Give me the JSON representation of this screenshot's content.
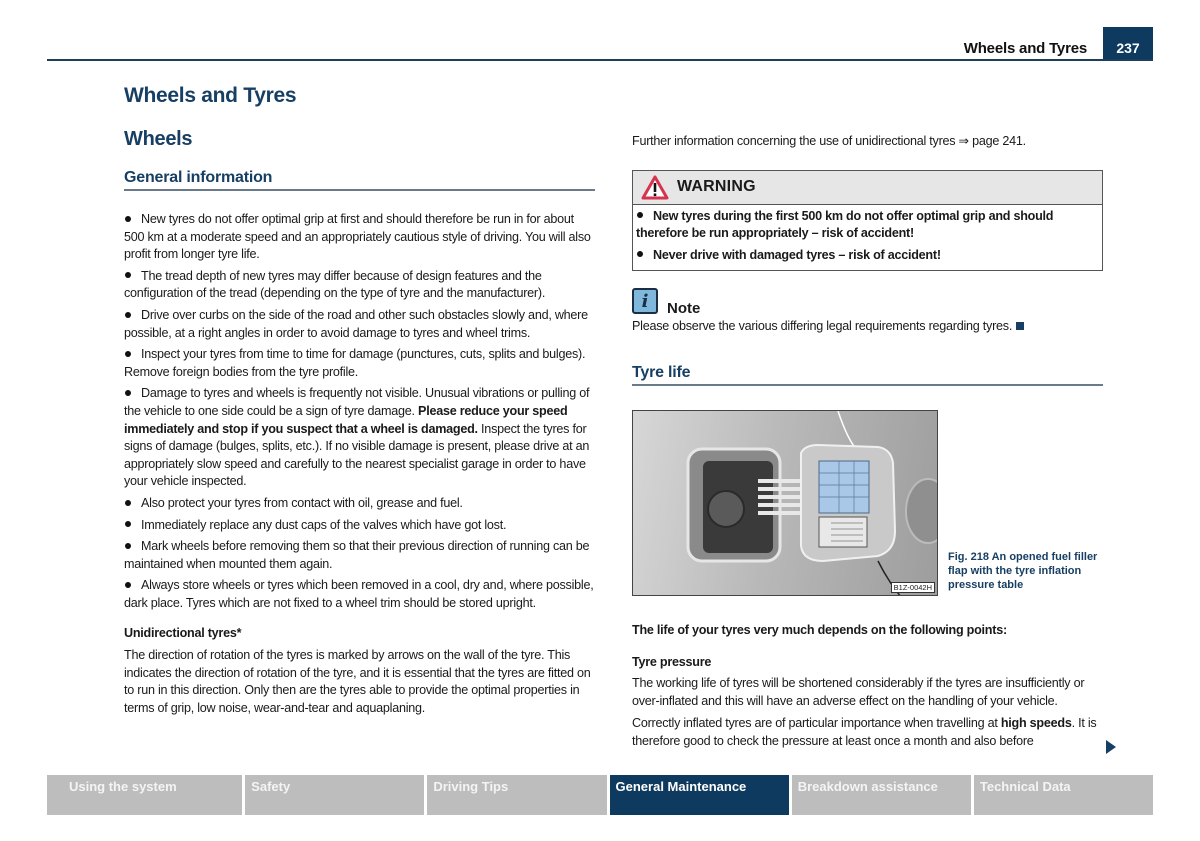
{
  "header": {
    "running_title": "Wheels and Tyres",
    "page_number": "237"
  },
  "left": {
    "chapter_title": "Wheels and Tyres",
    "section_title": "Wheels",
    "subsection_title": "General information",
    "bullets": [
      {
        "text": "New tyres do not offer optimal grip at first and should therefore be run in for about 500 km at a moderate speed and an appropriately cautious style of driving. You will also profit from longer tyre life."
      },
      {
        "text": "The tread depth of new tyres may differ because of design features and the configuration of the tread (depending on the type of tyre and the manufacturer)."
      },
      {
        "text": "Drive over curbs on the side of the road and other such obstacles slowly and, where possible, at a right angles in order to avoid damage to tyres and wheel trims."
      },
      {
        "text": "Inspect your tyres from time to time for damage (punctures, cuts, splits and bulges). Remove foreign bodies from the tyre profile."
      },
      {
        "text": "Damage to tyres and wheels is frequently not visible. Unusual vibrations or pulling of the vehicle to one side could be a sign of tyre damage. ",
        "bold": "Please reduce your speed immediately and stop if you suspect that a wheel is damaged.",
        "after": " Inspect the tyres for signs of damage (bulges, splits, etc.). If no visible damage is present, please drive at an appropriately slow speed and carefully to the nearest specialist garage in order to have your vehicle inspected."
      },
      {
        "text": "Also protect your tyres from contact with oil, grease and fuel."
      },
      {
        "text": "Immediately replace any dust caps of the valves which have got lost."
      },
      {
        "text": "Mark wheels before removing them so that their previous direction of running can be maintained when mounted them again."
      },
      {
        "text": "Always store wheels or tyres which been removed in a cool, dry and, where possible, dark place. Tyres which are not fixed to a wheel trim should be stored upright."
      }
    ],
    "unidirectional_heading": "Unidirectional tyres*",
    "unidirectional_text": "The direction of rotation of the tyres is marked by arrows on the wall of the tyre. This indicates the direction of rotation of the tyre, and it is essential that the tyres are fitted on to run in this direction. Only then are the tyres able to provide the optimal properties in terms of grip, low noise, wear-and-tear and aquaplaning."
  },
  "right": {
    "further_info": "Further information concerning the use of unidirectional tyres ⇒ page 241.",
    "warning": {
      "title": "WARNING",
      "items": [
        "New tyres during the first 500 km do not offer optimal grip and should therefore be run appropriately – risk of accident!",
        "Never drive with damaged tyres – risk of accident!"
      ]
    },
    "note": {
      "title": "Note",
      "text": "Please observe the various differing legal requirements regarding tyres."
    },
    "tyre_life_title": "Tyre life",
    "figure": {
      "code": "B1Z-0042H",
      "caption": "Fig. 218   An opened fuel filler flap with the tyre inflation pressure table"
    },
    "life_intro": "The life of your tyres very much depends on the following points:",
    "pressure_heading": "Tyre pressure",
    "pressure_text": "The working life of tyres will be shortened considerably if the tyres are insufficiently or over-inflated and this will have an adverse effect on the handling of your vehicle.",
    "speeds_pre": "Correctly inflated tyres are of particular importance when travelling at ",
    "speeds_bold": "high speeds",
    "speeds_post": ". It is therefore good to check the pressure at least once a month and also before"
  },
  "footer": {
    "tabs": [
      {
        "label": "Using the system",
        "active": false
      },
      {
        "label": "Safety",
        "active": false
      },
      {
        "label": "Driving Tips",
        "active": false
      },
      {
        "label": "General Maintenance",
        "active": true
      },
      {
        "label": "Breakdown assistance",
        "active": false
      },
      {
        "label": "Technical Data",
        "active": false
      }
    ]
  },
  "colors": {
    "brand_blue": "#0f3a5f",
    "heading_blue": "#173f63",
    "warning_red": "#d6334f",
    "note_blue": "#7fb8dc",
    "tab_grey": "#bdbdbd"
  }
}
